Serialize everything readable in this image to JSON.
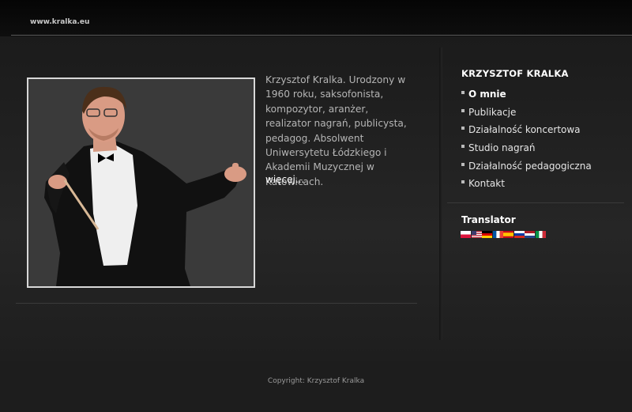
{
  "header": {
    "site_name": "www.kralka.eu"
  },
  "intro": {
    "text": "Krzysztof Kralka. Urodzony w 1960 roku, saksofonista, kompozytor, aranżer, realizator nagrań, publicysta,  pedagog. Absolwent Uniwersytetu Łódzkiego i Akademii Muzycznej w Katowicach.",
    "more_label": "więcej..."
  },
  "sidebar": {
    "title": "KRZYSZTOF KRALKA",
    "menu": [
      {
        "label": "O mnie",
        "active": true
      },
      {
        "label": "Publikacje"
      },
      {
        "label": "Działalność koncertowa"
      },
      {
        "label": "Studio nagrań"
      },
      {
        "label": "Działalność pedagogiczna"
      },
      {
        "label": "Kontakt"
      }
    ],
    "translator_title": "Translator",
    "flags": [
      "flag-pl-icon",
      "flag-us-icon",
      "flag-de-icon",
      "flag-fr-icon",
      "flag-es-icon",
      "flag-ru-icon",
      "flag-nl-icon",
      "flag-it-icon"
    ]
  },
  "footer": {
    "copyright": "Copyright: Krzysztof Kralka"
  }
}
